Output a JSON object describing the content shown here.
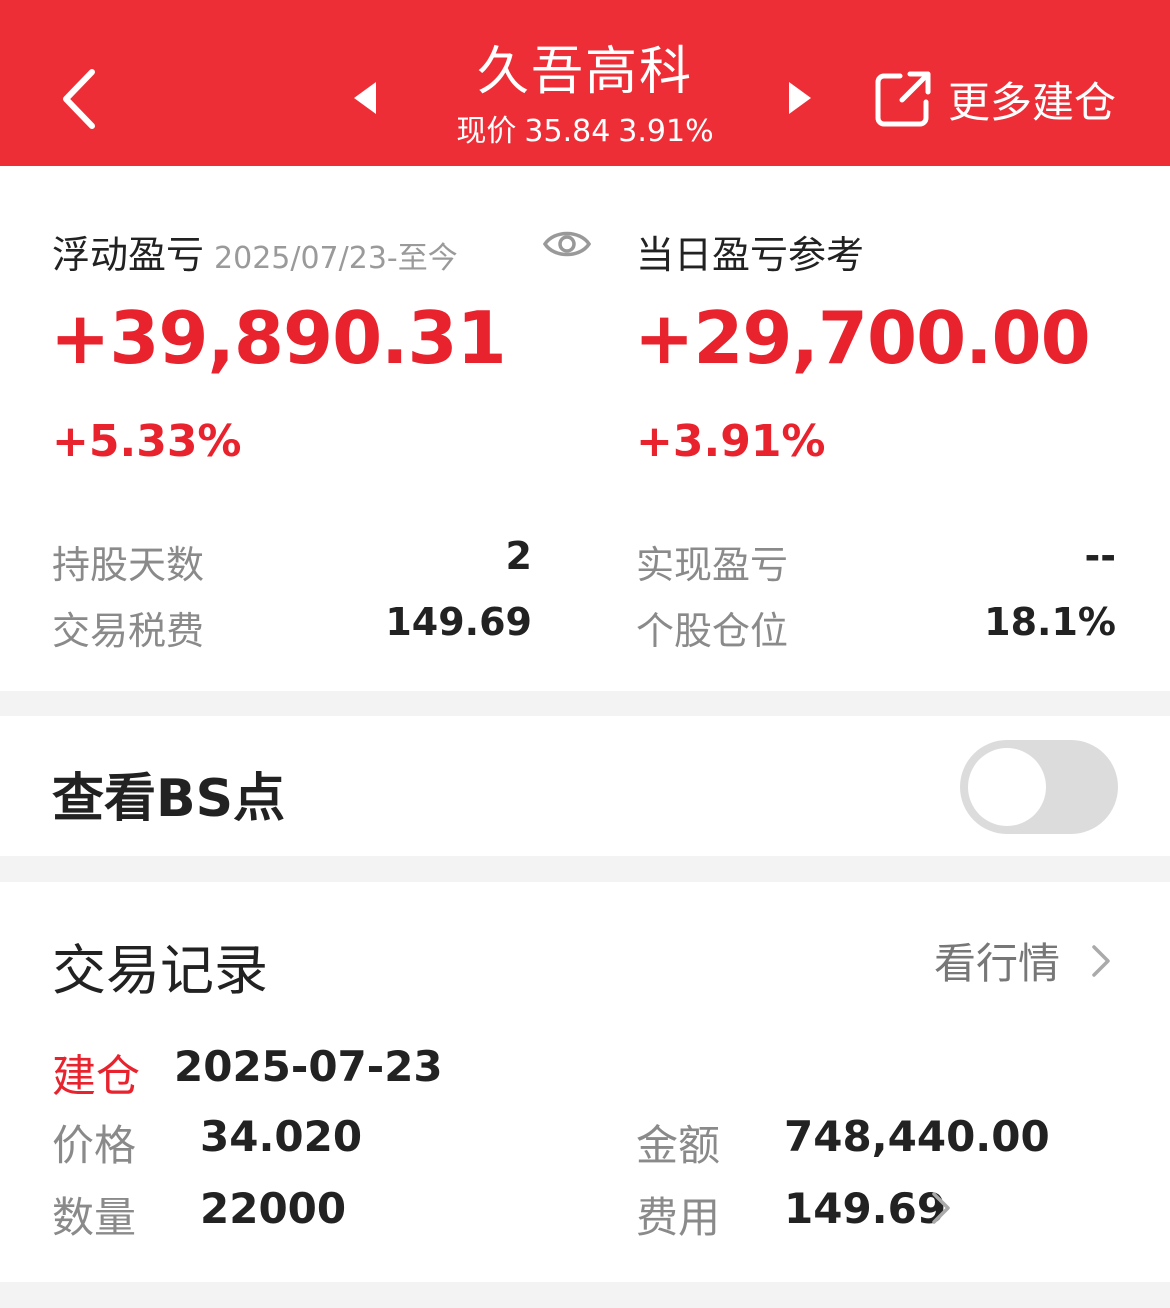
{
  "header": {
    "title": "久吾高科",
    "price_label": "现价",
    "price": "35.84",
    "change_pct": "3.91%",
    "more_label": "更多建仓",
    "bg_color": "#ee2e36"
  },
  "floating": {
    "label": "浮动盈亏",
    "date_range": "2025/07/23-至今",
    "amount": "+39,890.31",
    "pct": "+5.33%",
    "hold_days_label": "持股天数",
    "hold_days": "2",
    "tax_label": "交易税费",
    "tax": "149.69"
  },
  "daily": {
    "label": "当日盈亏参考",
    "amount": "+29,700.00",
    "pct": "+3.91%",
    "realized_label": "实现盈亏",
    "realized": "--",
    "position_label": "个股仓位",
    "position": "18.1%"
  },
  "bs": {
    "label": "查看BS点",
    "enabled": false
  },
  "records": {
    "title": "交易记录",
    "market_link": "看行情",
    "items": [
      {
        "type": "建仓",
        "date": "2025-07-23",
        "price_label": "价格",
        "price": "34.020",
        "amount_label": "金额",
        "amount": "748,440.00",
        "qty_label": "数量",
        "qty": "22000",
        "fee_label": "费用",
        "fee": "149.69"
      }
    ]
  },
  "colors": {
    "accent": "#e8232e",
    "header": "#ee2e36"
  }
}
